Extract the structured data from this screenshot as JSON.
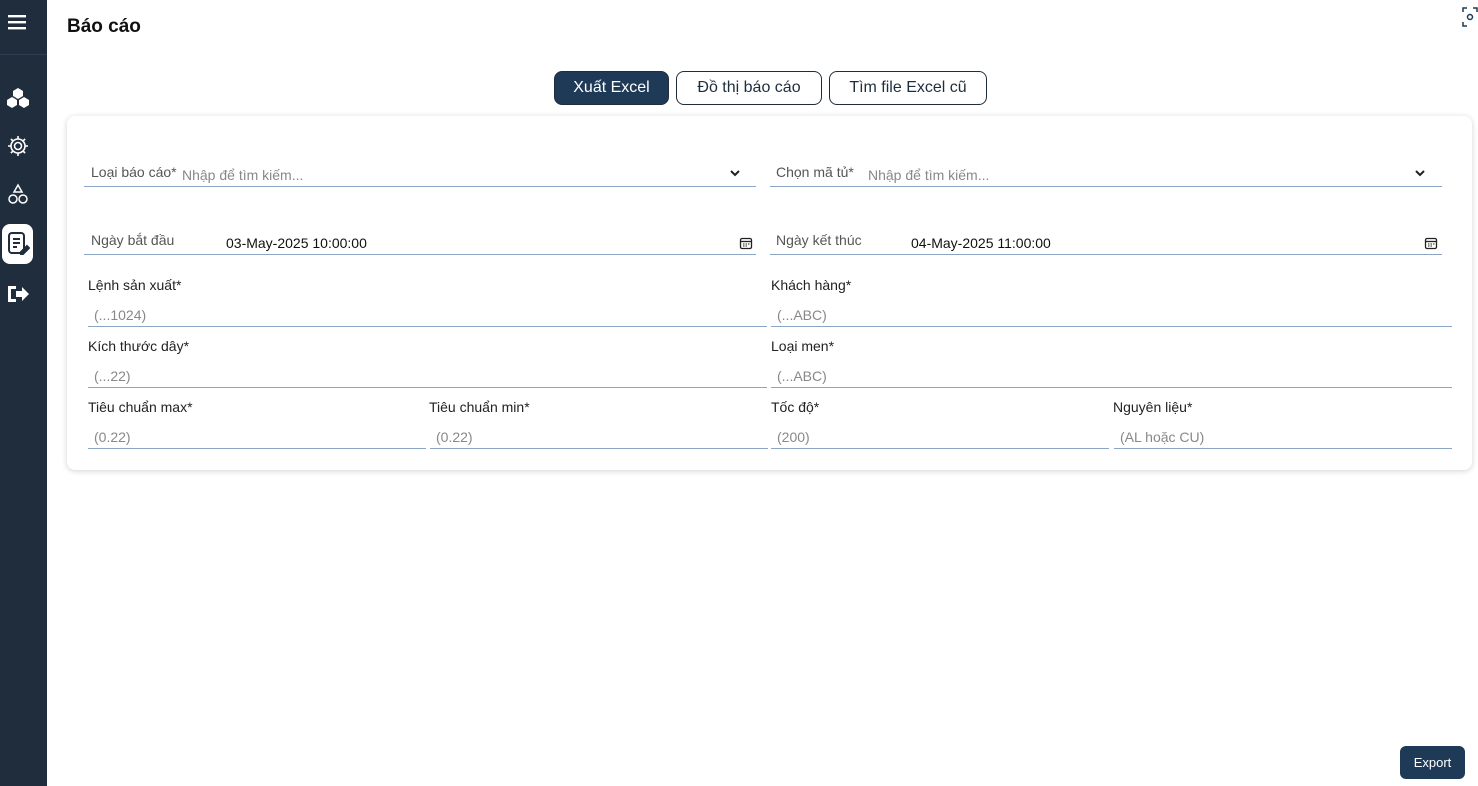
{
  "page": {
    "title": "Báo cáo"
  },
  "sidebar": {
    "items": [
      {
        "icon": "menu-icon"
      },
      {
        "icon": "boxes-icon"
      },
      {
        "icon": "gear-icon"
      },
      {
        "icon": "materials-icon"
      },
      {
        "icon": "report-icon",
        "active": true
      },
      {
        "icon": "logout-icon"
      }
    ]
  },
  "tabs": [
    {
      "label": "Xuất Excel",
      "active": true
    },
    {
      "label": "Đồ thị báo cáo",
      "active": false
    },
    {
      "label": "Tìm file Excel cũ",
      "active": false
    }
  ],
  "form": {
    "report_type": {
      "label": "Loại báo cáo*",
      "placeholder": "Nhập để tìm kiếm..."
    },
    "cabinet": {
      "label": "Chọn mã tủ*",
      "placeholder": "Nhập để tìm kiếm..."
    },
    "start_date": {
      "label": "Ngày bắt đầu",
      "value": "03-May-2025 10:00:00"
    },
    "end_date": {
      "label": "Ngày kết thúc",
      "value": "04-May-2025 11:00:00"
    },
    "production_order": {
      "label": "Lệnh sản xuất*",
      "placeholder": "(...1024)"
    },
    "customer": {
      "label": "Khách hàng*",
      "placeholder": "(...ABC)"
    },
    "wire_size": {
      "label": "Kích thước dây*",
      "placeholder": "(...22)"
    },
    "enamel_type": {
      "label": "Loại men*",
      "placeholder": "(...ABC)"
    },
    "std_max": {
      "label": "Tiêu chuẩn max*",
      "placeholder": "(0.22)"
    },
    "std_min": {
      "label": "Tiêu chuẩn min*",
      "placeholder": "(0.22)"
    },
    "speed": {
      "label": "Tốc độ*",
      "placeholder": "(200)"
    },
    "material": {
      "label": "Nguyên liệu*",
      "placeholder": "(AL hoặc CU)"
    }
  },
  "export_button": "Export",
  "colors": {
    "sidebar": "#1f2d3d",
    "accent": "#1f3a56",
    "underline": "#8aa6c4"
  }
}
